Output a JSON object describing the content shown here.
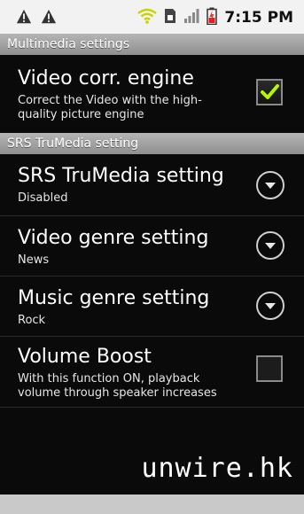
{
  "status_bar": {
    "time": "7:15 PM",
    "icons": [
      "warning-icon",
      "warning-icon",
      "wifi-icon",
      "sim-icon",
      "signal-icon",
      "battery-icon"
    ]
  },
  "sections": [
    {
      "title": "Multimedia settings"
    },
    {
      "title": "SRS TruMedia setting"
    }
  ],
  "items": [
    {
      "title": "Video corr. engine",
      "subtitle": "Correct the Video with the high-quality picture engine",
      "control": "checkbox",
      "checked": true
    },
    {
      "title": "SRS TruMedia setting",
      "subtitle": "Disabled",
      "control": "dropdown"
    },
    {
      "title": "Video genre setting",
      "subtitle": "News",
      "control": "dropdown"
    },
    {
      "title": "Music genre setting",
      "subtitle": "Rock",
      "control": "dropdown"
    },
    {
      "title": "Volume Boost",
      "subtitle": "With this function ON, playback volume through speaker increases",
      "control": "checkbox",
      "checked": false
    }
  ],
  "watermark": "unwire.hk",
  "colors": {
    "accent": "#b7f500",
    "section_bg": "#9f9f9f"
  }
}
